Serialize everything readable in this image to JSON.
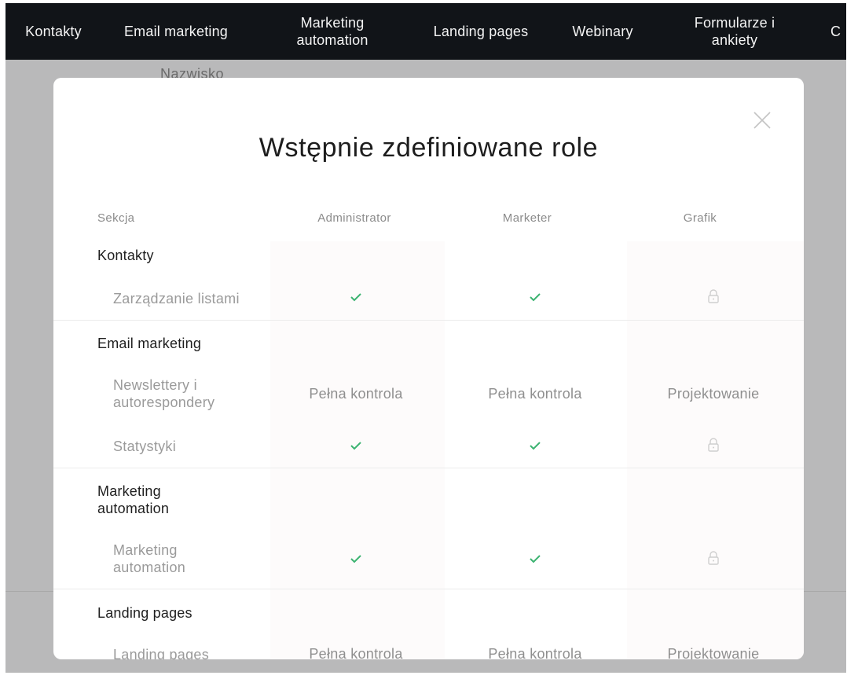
{
  "nav": {
    "items": [
      {
        "label": "Kontakty"
      },
      {
        "label": "Email marketing"
      },
      {
        "label": "Marketing\nautomation"
      },
      {
        "label": "Landing pages"
      },
      {
        "label": "Webinary"
      },
      {
        "label": "Formularze i\nankiety"
      },
      {
        "label": "C"
      }
    ]
  },
  "background": {
    "field_label": "Nazwisko"
  },
  "modal": {
    "title": "Wstępnie zdefiniowane role",
    "columns": {
      "section": "Sekcja",
      "admin": "Administrator",
      "marketer": "Marketer",
      "designer": "Grafik"
    },
    "sections": [
      {
        "title": "Kontakty",
        "rows": [
          {
            "feature": "Zarządzanie listami",
            "admin": "check",
            "marketer": "check",
            "designer": "lock"
          }
        ]
      },
      {
        "title": "Email marketing",
        "rows": [
          {
            "feature": "Newslettery i\nautorespondery",
            "admin": "Pełna kontrola",
            "marketer": "Pełna kontrola",
            "designer": "Projektowanie"
          },
          {
            "feature": "Statystyki",
            "admin": "check",
            "marketer": "check",
            "designer": "lock"
          }
        ]
      },
      {
        "title": "Marketing\nautomation",
        "rows": [
          {
            "feature": "Marketing\nautomation",
            "admin": "check",
            "marketer": "check",
            "designer": "lock"
          }
        ]
      },
      {
        "title": "Landing pages",
        "rows": [
          {
            "feature": "Landing pages",
            "admin": "Pełna kontrola",
            "marketer": "Pełna kontrola",
            "designer": "Projektowanie"
          }
        ]
      }
    ]
  },
  "icons": {
    "check": "check-icon",
    "lock": "lock-icon",
    "close": "close-icon"
  },
  "colors": {
    "nav_bg": "#111418",
    "check": "#3cb371",
    "lock": "#c9c9c9",
    "overlay": "#b9b9ba"
  }
}
